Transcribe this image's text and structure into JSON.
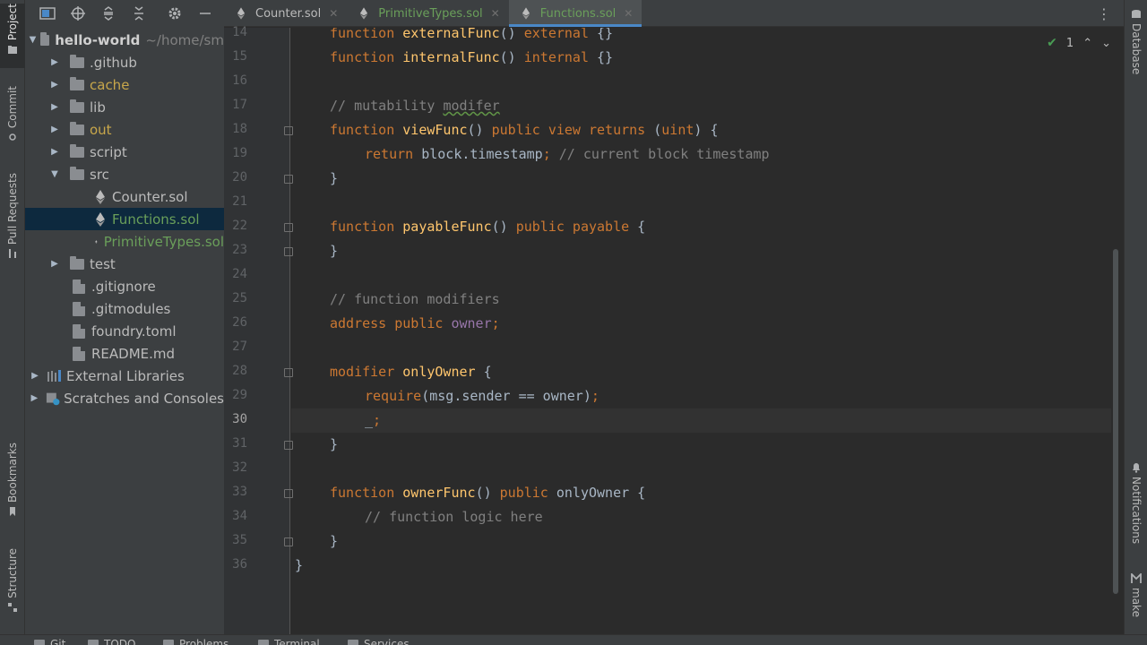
{
  "left_strip": {
    "project": "Project",
    "commit": "Commit",
    "pull_requests": "Pull Requests",
    "bookmarks": "Bookmarks",
    "structure": "Structure"
  },
  "right_strip": {
    "database": "Database",
    "notifications": "Notifications",
    "make": "make"
  },
  "project_tree": {
    "root_name": "hello-world",
    "root_path": "~/home/sm",
    "items": [
      {
        "label": ".github"
      },
      {
        "label": "cache"
      },
      {
        "label": "lib"
      },
      {
        "label": "out"
      },
      {
        "label": "script"
      },
      {
        "label": "src"
      },
      {
        "label": "Counter.sol"
      },
      {
        "label": "Functions.sol"
      },
      {
        "label": "PrimitiveTypes.sol"
      },
      {
        "label": "test"
      },
      {
        "label": ".gitignore"
      },
      {
        "label": ".gitmodules"
      },
      {
        "label": "foundry.toml"
      },
      {
        "label": "README.md"
      },
      {
        "label": "External Libraries"
      },
      {
        "label": "Scratches and Consoles"
      }
    ]
  },
  "tabs": [
    {
      "label": "Counter.sol"
    },
    {
      "label": "PrimitiveTypes.sol"
    },
    {
      "label": "Functions.sol"
    }
  ],
  "inspections": {
    "count": "1"
  },
  "line_numbers": [
    "14",
    "15",
    "16",
    "17",
    "18",
    "19",
    "20",
    "21",
    "22",
    "23",
    "24",
    "25",
    "26",
    "27",
    "28",
    "29",
    "30",
    "31",
    "32",
    "33",
    "34",
    "35",
    "36"
  ],
  "code": {
    "l14": {
      "kw": "function",
      "fn": "externalFunc",
      "rest": "() ",
      "kw2": "external",
      "tail": " {}"
    },
    "l15": {
      "kw": "function",
      "fn": "internalFunc",
      "rest": "() ",
      "kw2": "internal",
      "tail": " {}"
    },
    "l17": {
      "cm": "// mutability ",
      "cm2": "modifer"
    },
    "l18": {
      "kw": "function",
      "fn": "viewFunc",
      "rest": "() ",
      "kw2": "public view returns",
      "p1": " (",
      "kw3": "uint",
      "tail": ") {"
    },
    "l19": {
      "kw": "return",
      "plain": " block.timestamp",
      "semi": ";",
      "cm": " // current block timestamp"
    },
    "l20": {
      "plain": "}"
    },
    "l22": {
      "kw": "function",
      "fn": "payableFunc",
      "rest": "() ",
      "kw2": "public payable",
      "tail": " {"
    },
    "l23": {
      "plain": "}"
    },
    "l25": {
      "cm": "// function modifiers"
    },
    "l26": {
      "kw": "address public",
      "var": " owner",
      "semi": ";"
    },
    "l28": {
      "kw": "modifier",
      "fn": " onlyOwner",
      "tail": " {"
    },
    "l29": {
      "kw": "require",
      "plain": "(msg.sender == owner)",
      "semi": ";"
    },
    "l30": {
      "plain": "_",
      "semi": ";"
    },
    "l31": {
      "plain": "}"
    },
    "l33": {
      "kw": "function",
      "fn": "ownerFunc",
      "rest": "() ",
      "kw2": "public",
      "plain": " onlyOwner",
      "tail": " {"
    },
    "l34": {
      "cm": "// function logic here"
    },
    "l35": {
      "plain": "}"
    },
    "l36": {
      "plain": "}"
    }
  },
  "bottom_tools": [
    "Git",
    "TODO",
    "Problems",
    "Terminal",
    "Services"
  ]
}
